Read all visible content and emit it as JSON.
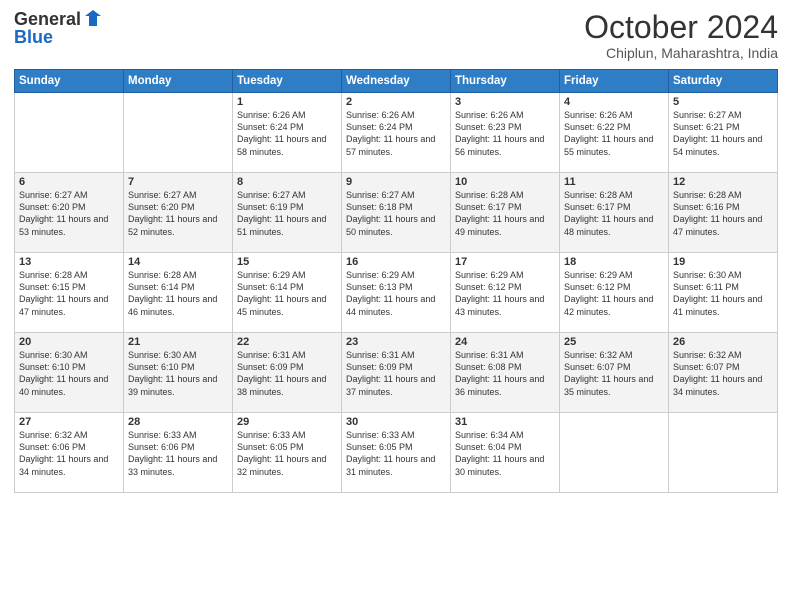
{
  "logo": {
    "general": "General",
    "blue": "Blue"
  },
  "header": {
    "month": "October 2024",
    "location": "Chiplun, Maharashtra, India"
  },
  "weekdays": [
    "Sunday",
    "Monday",
    "Tuesday",
    "Wednesday",
    "Thursday",
    "Friday",
    "Saturday"
  ],
  "weeks": [
    [
      {
        "day": "",
        "sunrise": "",
        "sunset": "",
        "daylight": ""
      },
      {
        "day": "",
        "sunrise": "",
        "sunset": "",
        "daylight": ""
      },
      {
        "day": "1",
        "sunrise": "Sunrise: 6:26 AM",
        "sunset": "Sunset: 6:24 PM",
        "daylight": "Daylight: 11 hours and 58 minutes."
      },
      {
        "day": "2",
        "sunrise": "Sunrise: 6:26 AM",
        "sunset": "Sunset: 6:24 PM",
        "daylight": "Daylight: 11 hours and 57 minutes."
      },
      {
        "day": "3",
        "sunrise": "Sunrise: 6:26 AM",
        "sunset": "Sunset: 6:23 PM",
        "daylight": "Daylight: 11 hours and 56 minutes."
      },
      {
        "day": "4",
        "sunrise": "Sunrise: 6:26 AM",
        "sunset": "Sunset: 6:22 PM",
        "daylight": "Daylight: 11 hours and 55 minutes."
      },
      {
        "day": "5",
        "sunrise": "Sunrise: 6:27 AM",
        "sunset": "Sunset: 6:21 PM",
        "daylight": "Daylight: 11 hours and 54 minutes."
      }
    ],
    [
      {
        "day": "6",
        "sunrise": "Sunrise: 6:27 AM",
        "sunset": "Sunset: 6:20 PM",
        "daylight": "Daylight: 11 hours and 53 minutes."
      },
      {
        "day": "7",
        "sunrise": "Sunrise: 6:27 AM",
        "sunset": "Sunset: 6:20 PM",
        "daylight": "Daylight: 11 hours and 52 minutes."
      },
      {
        "day": "8",
        "sunrise": "Sunrise: 6:27 AM",
        "sunset": "Sunset: 6:19 PM",
        "daylight": "Daylight: 11 hours and 51 minutes."
      },
      {
        "day": "9",
        "sunrise": "Sunrise: 6:27 AM",
        "sunset": "Sunset: 6:18 PM",
        "daylight": "Daylight: 11 hours and 50 minutes."
      },
      {
        "day": "10",
        "sunrise": "Sunrise: 6:28 AM",
        "sunset": "Sunset: 6:17 PM",
        "daylight": "Daylight: 11 hours and 49 minutes."
      },
      {
        "day": "11",
        "sunrise": "Sunrise: 6:28 AM",
        "sunset": "Sunset: 6:17 PM",
        "daylight": "Daylight: 11 hours and 48 minutes."
      },
      {
        "day": "12",
        "sunrise": "Sunrise: 6:28 AM",
        "sunset": "Sunset: 6:16 PM",
        "daylight": "Daylight: 11 hours and 47 minutes."
      }
    ],
    [
      {
        "day": "13",
        "sunrise": "Sunrise: 6:28 AM",
        "sunset": "Sunset: 6:15 PM",
        "daylight": "Daylight: 11 hours and 47 minutes."
      },
      {
        "day": "14",
        "sunrise": "Sunrise: 6:28 AM",
        "sunset": "Sunset: 6:14 PM",
        "daylight": "Daylight: 11 hours and 46 minutes."
      },
      {
        "day": "15",
        "sunrise": "Sunrise: 6:29 AM",
        "sunset": "Sunset: 6:14 PM",
        "daylight": "Daylight: 11 hours and 45 minutes."
      },
      {
        "day": "16",
        "sunrise": "Sunrise: 6:29 AM",
        "sunset": "Sunset: 6:13 PM",
        "daylight": "Daylight: 11 hours and 44 minutes."
      },
      {
        "day": "17",
        "sunrise": "Sunrise: 6:29 AM",
        "sunset": "Sunset: 6:12 PM",
        "daylight": "Daylight: 11 hours and 43 minutes."
      },
      {
        "day": "18",
        "sunrise": "Sunrise: 6:29 AM",
        "sunset": "Sunset: 6:12 PM",
        "daylight": "Daylight: 11 hours and 42 minutes."
      },
      {
        "day": "19",
        "sunrise": "Sunrise: 6:30 AM",
        "sunset": "Sunset: 6:11 PM",
        "daylight": "Daylight: 11 hours and 41 minutes."
      }
    ],
    [
      {
        "day": "20",
        "sunrise": "Sunrise: 6:30 AM",
        "sunset": "Sunset: 6:10 PM",
        "daylight": "Daylight: 11 hours and 40 minutes."
      },
      {
        "day": "21",
        "sunrise": "Sunrise: 6:30 AM",
        "sunset": "Sunset: 6:10 PM",
        "daylight": "Daylight: 11 hours and 39 minutes."
      },
      {
        "day": "22",
        "sunrise": "Sunrise: 6:31 AM",
        "sunset": "Sunset: 6:09 PM",
        "daylight": "Daylight: 11 hours and 38 minutes."
      },
      {
        "day": "23",
        "sunrise": "Sunrise: 6:31 AM",
        "sunset": "Sunset: 6:09 PM",
        "daylight": "Daylight: 11 hours and 37 minutes."
      },
      {
        "day": "24",
        "sunrise": "Sunrise: 6:31 AM",
        "sunset": "Sunset: 6:08 PM",
        "daylight": "Daylight: 11 hours and 36 minutes."
      },
      {
        "day": "25",
        "sunrise": "Sunrise: 6:32 AM",
        "sunset": "Sunset: 6:07 PM",
        "daylight": "Daylight: 11 hours and 35 minutes."
      },
      {
        "day": "26",
        "sunrise": "Sunrise: 6:32 AM",
        "sunset": "Sunset: 6:07 PM",
        "daylight": "Daylight: 11 hours and 34 minutes."
      }
    ],
    [
      {
        "day": "27",
        "sunrise": "Sunrise: 6:32 AM",
        "sunset": "Sunset: 6:06 PM",
        "daylight": "Daylight: 11 hours and 34 minutes."
      },
      {
        "day": "28",
        "sunrise": "Sunrise: 6:33 AM",
        "sunset": "Sunset: 6:06 PM",
        "daylight": "Daylight: 11 hours and 33 minutes."
      },
      {
        "day": "29",
        "sunrise": "Sunrise: 6:33 AM",
        "sunset": "Sunset: 6:05 PM",
        "daylight": "Daylight: 11 hours and 32 minutes."
      },
      {
        "day": "30",
        "sunrise": "Sunrise: 6:33 AM",
        "sunset": "Sunset: 6:05 PM",
        "daylight": "Daylight: 11 hours and 31 minutes."
      },
      {
        "day": "31",
        "sunrise": "Sunrise: 6:34 AM",
        "sunset": "Sunset: 6:04 PM",
        "daylight": "Daylight: 11 hours and 30 minutes."
      },
      {
        "day": "",
        "sunrise": "",
        "sunset": "",
        "daylight": ""
      },
      {
        "day": "",
        "sunrise": "",
        "sunset": "",
        "daylight": ""
      }
    ]
  ]
}
